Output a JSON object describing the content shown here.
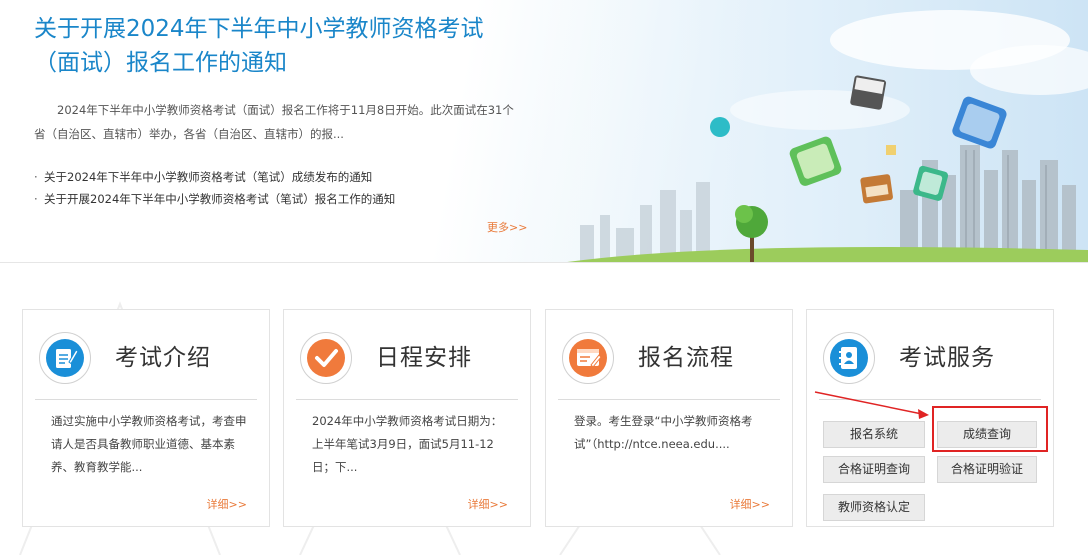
{
  "banner": {
    "title": "关于开展2024年下半年中小学教师资格考试（面试）报名工作的通知",
    "summary": "2024年下半年中小学教师资格考试（面试）报名工作将于11月8日开始。此次面试在31个省（自治区、直辖市）举办，各省（自治区、直辖市）的报...",
    "news": [
      {
        "bullet": "·",
        "text": "关于2024年下半年中小学教师资格考试（笔试）成绩发布的通知"
      },
      {
        "bullet": "·",
        "text": "关于开展2024年下半年中小学教师资格考试（笔试）报名工作的通知"
      }
    ],
    "more_label": "更多>>"
  },
  "cards": [
    {
      "icon": "document-pen-icon",
      "title": "考试介绍",
      "body": "通过实施中小学教师资格考试，考查申请人是否具备教师职业道德、基本素养、教育教学能...",
      "more": "详细>>"
    },
    {
      "icon": "checkmark-icon",
      "title": "日程安排",
      "body": "2024年中小学教师资格考试日期为：上半年笔试3月9日，面试5月11-12日；下...",
      "more": "详细>>"
    },
    {
      "icon": "registration-screen-icon",
      "title": "报名流程",
      "body": "登录。考生登录“中小学教师资格考试”（http://ntce.neea.edu....",
      "more": "详细>>"
    },
    {
      "icon": "contact-book-icon",
      "title": "考试服务"
    }
  ],
  "services": {
    "registration": "报名系统",
    "score_query": "成绩查询",
    "certificate_query": "合格证明查询",
    "certificate_verify": "合格证明验证",
    "qualification_cert": "教师资格认定"
  },
  "colors": {
    "title_blue": "#1a86c9",
    "more_orange": "#e97a3a",
    "icon_orange": "#f07a3c",
    "icon_blue": "#1a8fd8",
    "highlight_red": "#e02424"
  }
}
